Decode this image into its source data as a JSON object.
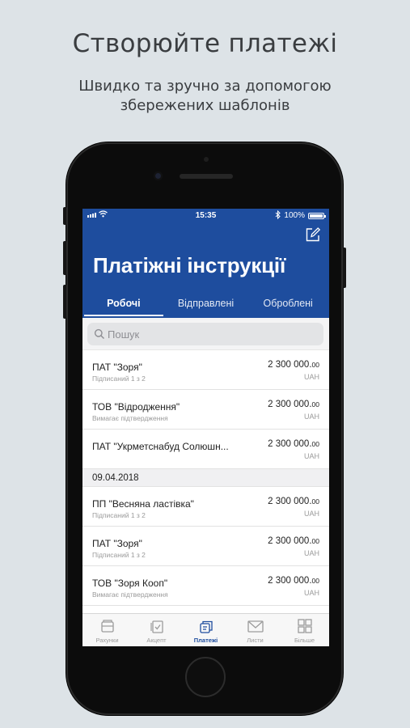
{
  "promo": {
    "title": "Створюйте платежі",
    "subtitle_line1": "Швидко та зручно за допомогою",
    "subtitle_line2": "збережених шаблонів"
  },
  "status_bar": {
    "time": "15:35",
    "battery": "100%",
    "bluetooth_icon": "bluetooth-icon",
    "wifi_icon": "wifi-icon"
  },
  "header": {
    "title": "Платіжні інструкції",
    "compose_icon": "compose-icon",
    "tabs": [
      {
        "label": "Робочі",
        "active": true
      },
      {
        "label": "Відправлені",
        "active": false
      },
      {
        "label": "Оброблені",
        "active": false
      }
    ]
  },
  "search": {
    "placeholder": "Пошук"
  },
  "payments_today": [
    {
      "name": "ПАТ \"Зоря\"",
      "status": "Підписаний 1 з 2",
      "amount_main": "2 300 000.",
      "amount_dec": "00",
      "currency": "UAH"
    },
    {
      "name": "ТОВ \"Відродження\"",
      "status": "Вимагає підтвердження",
      "amount_main": "2 300 000.",
      "amount_dec": "00",
      "currency": "UAH"
    },
    {
      "name": "ПАТ \"Укрметснабуд Солюшн...",
      "status": "",
      "amount_main": "2 300 000.",
      "amount_dec": "00",
      "currency": "UAH"
    }
  ],
  "section_date": "09.04.2018",
  "payments_dated": [
    {
      "name": "ПП \"Весняна ластівка\"",
      "status": "Підписаний 1 з 2",
      "amount_main": "2 300 000.",
      "amount_dec": "00",
      "currency": "UAH"
    },
    {
      "name": "ПАТ \"Зоря\"",
      "status": "Підписаний 1 з 2",
      "amount_main": "2 300 000.",
      "amount_dec": "00",
      "currency": "UAH"
    },
    {
      "name": "ТОВ \"Зоря Кооп\"",
      "status": "Вимагає підтвердження",
      "amount_main": "2 300 000.",
      "amount_dec": "00",
      "currency": "UAH"
    }
  ],
  "tabbar": [
    {
      "label": "Рахунки",
      "icon": "accounts-icon",
      "active": false
    },
    {
      "label": "Акцепт",
      "icon": "accept-icon",
      "active": false
    },
    {
      "label": "Платежі",
      "icon": "payments-icon",
      "active": true
    },
    {
      "label": "Листи",
      "icon": "mail-icon",
      "active": false
    },
    {
      "label": "Більше",
      "icon": "more-grid-icon",
      "active": false
    }
  ],
  "colors": {
    "brand_blue": "#1e4d9e",
    "background": "#dde3e7"
  }
}
